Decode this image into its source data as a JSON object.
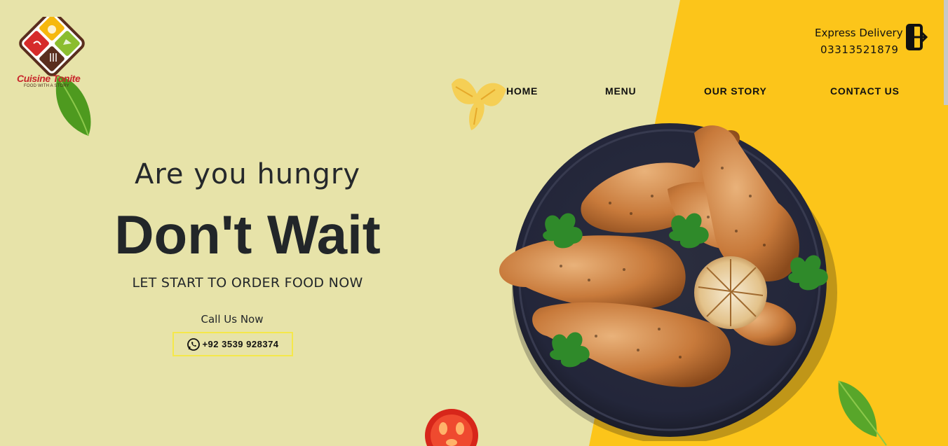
{
  "brand": {
    "name": "Cuisine Tonite",
    "tagline": "FOOD WITH A STORY"
  },
  "header": {
    "express_title": "Express Delivery",
    "express_phone": "03313521879"
  },
  "nav": {
    "items": [
      {
        "label": "HOME"
      },
      {
        "label": "MENU"
      },
      {
        "label": "OUR STORY"
      },
      {
        "label": "CONTACT US"
      }
    ]
  },
  "hero": {
    "question": "Are you hungry",
    "headline": "Don't Wait",
    "subheadline": "LET START TO ORDER FOOD NOW",
    "call_label": "Call Us Now",
    "call_number": "+92 3539 928374"
  },
  "colors": {
    "background": "#e7e3a9",
    "accent": "#fcc51a",
    "text": "#222629",
    "button_border": "#f5e84a"
  },
  "icons": {
    "delivery": "exit-icon",
    "call": "whatsapp-icon"
  }
}
